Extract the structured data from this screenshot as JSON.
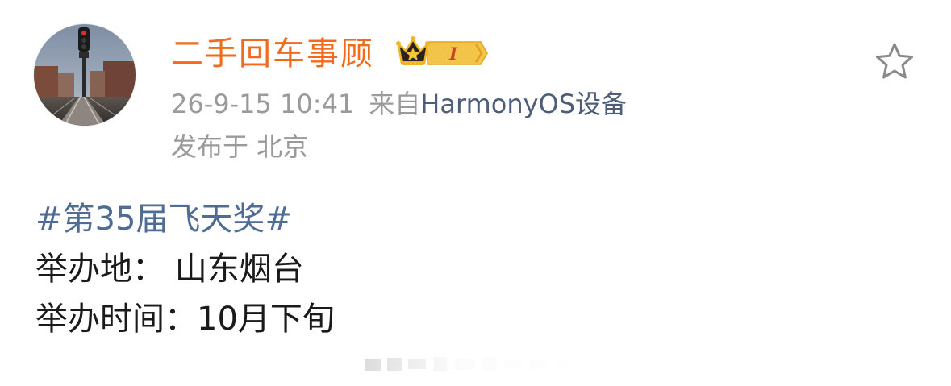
{
  "user": {
    "name": "二手回车事顾",
    "badge_level": "I"
  },
  "meta": {
    "time": "26-9-15 10:41",
    "from_label": "来自",
    "device": "HarmonyOS设备",
    "location": "发布于 北京"
  },
  "post": {
    "hashtag": "#第35届飞天奖#",
    "line2": "举办地： 山东烟台",
    "line3": "举办时间：10月下旬"
  },
  "icons": {
    "avatar": "avatar-railway-photo",
    "badge": "crown-level-badge",
    "favorite": "star-outline-icon"
  },
  "colors": {
    "username": "#f26b1d",
    "hashtag": "#4f6c95",
    "device_link": "#4f5e78",
    "meta": "#9a9a9a",
    "body_text": "#1a1a1a"
  }
}
